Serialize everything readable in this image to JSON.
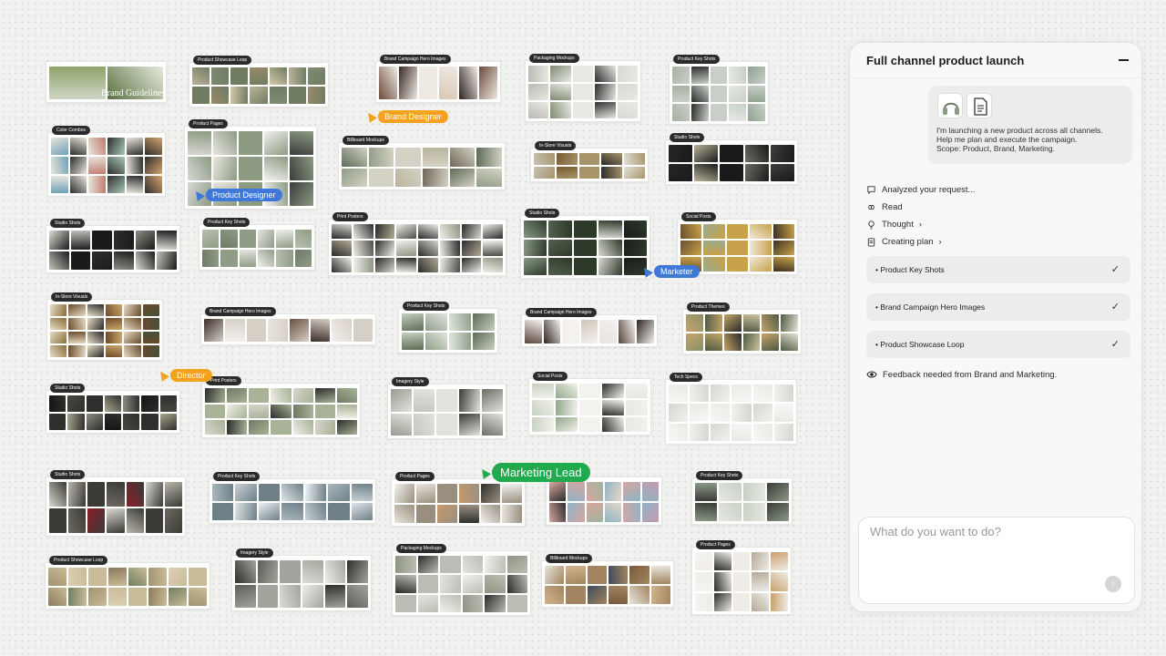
{
  "canvas": {
    "boards": [
      {
        "label": "",
        "cols": 2,
        "rows": 1,
        "palette": [
          "#cfd6c7",
          "#8ea56a",
          "#e6ebe0",
          "#5a7040"
        ],
        "caption": "Brand Guidelines"
      },
      {
        "label": "Product Showcase Loop",
        "cols": 7,
        "rows": 2,
        "palette": [
          "#9a8a6a",
          "#bdb49a",
          "#6f7c62",
          "#d6c9a8",
          "#7e8c74"
        ]
      },
      {
        "label": "Brand Campaign Hero Images",
        "cols": 6,
        "rows": 1,
        "palette": [
          "#3a2a24",
          "#d9c7b5",
          "#6b4b3a",
          "#efe9e3",
          "#2c2422"
        ]
      },
      {
        "label": "Packaging Mockups",
        "cols": 5,
        "rows": 3,
        "palette": [
          "#d9d8d2",
          "#7f8a72",
          "#2f2f2f",
          "#b9b9b2",
          "#e9e8e4"
        ]
      },
      {
        "label": "Product Key Shots",
        "cols": 5,
        "rows": 3,
        "palette": [
          "#c9cfc8",
          "#8fa38f",
          "#2b2b2b",
          "#e7e9e5",
          "#a8b1a2"
        ]
      },
      {
        "label": "Color Combos",
        "cols": 6,
        "rows": 3,
        "palette": [
          "#6fa0b7",
          "#d3a36e",
          "#2d2d2d",
          "#a8c9b9",
          "#c17b6d",
          "#e9e6dc"
        ]
      },
      {
        "label": "Product Pages",
        "cols": 5,
        "rows": 3,
        "palette": [
          "#f2f2f0",
          "#d8d8d4",
          "#8c9a82",
          "#3c3c3c",
          "#e9e6e0"
        ]
      },
      {
        "label": "Billboard Mockups",
        "cols": 6,
        "rows": 2,
        "palette": [
          "#8f9c86",
          "#b9b49e",
          "#5d6b58",
          "#d4d2c4",
          "#6f6658"
        ]
      },
      {
        "label": "In-Store Visuals",
        "cols": 5,
        "rows": 2,
        "palette": [
          "#e3e1db",
          "#7a5a2e",
          "#2a2a2a",
          "#c7c3b7",
          "#a7946a"
        ]
      },
      {
        "label": "Studio Shots",
        "cols": 5,
        "rows": 2,
        "palette": [
          "#1a1a1a",
          "#3d3d3a",
          "#b7b29a",
          "#6b6e62",
          "#262626"
        ]
      },
      {
        "label": "Studio Shots",
        "cols": 6,
        "rows": 2,
        "palette": [
          "#dedcd6",
          "#1b1b1b",
          "#8a8f86",
          "#bfc3bb",
          "#2e2e2e"
        ]
      },
      {
        "label": "Product Key Shots",
        "cols": 6,
        "rows": 2,
        "palette": [
          "#e4e4df",
          "#b8bfb0",
          "#8f9c86",
          "#f1f1ee",
          "#6f7a67"
        ]
      },
      {
        "label": "Print Posters",
        "cols": 8,
        "rows": 3,
        "palette": [
          "#2a2a2a",
          "#d7d5cf",
          "#8d9583",
          "#f0efe9",
          "#4c4c48",
          "#b0aa95"
        ]
      },
      {
        "label": "Studio Shots",
        "cols": 5,
        "rows": 3,
        "palette": [
          "#1c1c1c",
          "#54604d",
          "#d9d8d2",
          "#8a9985",
          "#2d3a2a"
        ]
      },
      {
        "label": "Social Posts",
        "cols": 5,
        "rows": 3,
        "palette": [
          "#c8a24a",
          "#3a2f22",
          "#9cab8d",
          "#efe8d8",
          "#6a4d2c"
        ]
      },
      {
        "label": "In-Store Visuals",
        "cols": 6,
        "rows": 4,
        "palette": [
          "#6b4a2a",
          "#c9a86a",
          "#2a2a2a",
          "#e6dcc6",
          "#8a6d3b",
          "#445039"
        ]
      },
      {
        "label": "Brand Campaign Hero Images",
        "cols": 8,
        "rows": 1,
        "palette": [
          "#e9e5df",
          "#3a2e28",
          "#d6cfc6",
          "#6a4e3e",
          "#f3f1ee"
        ]
      },
      {
        "label": "Product Key Shots",
        "cols": 4,
        "rows": 2,
        "palette": [
          "#8fa08a",
          "#c7cfc1",
          "#5b6b55",
          "#e2e6de"
        ]
      },
      {
        "label": "Brand Campaign Hero Images",
        "cols": 7,
        "rows": 1,
        "palette": [
          "#e6e2dc",
          "#2e2622",
          "#cfc5b9",
          "#57443a",
          "#f4f2ef"
        ]
      },
      {
        "label": "Product Themes",
        "cols": 6,
        "rows": 2,
        "palette": [
          "#2a2a28",
          "#c4a46a",
          "#8b8f6a",
          "#e8e3d5",
          "#4e5a44",
          "#d0c3a0"
        ]
      },
      {
        "label": "Studio Shots",
        "cols": 7,
        "rows": 2,
        "palette": [
          "#141414",
          "#2f2f2d",
          "#8c8c80",
          "#474742",
          "#a8a58e"
        ]
      },
      {
        "label": "Print Posters",
        "cols": 7,
        "rows": 3,
        "palette": [
          "#f1efe9",
          "#2b2b2b",
          "#a7b296",
          "#d8d5cc",
          "#6f7a66"
        ]
      },
      {
        "label": "Imagery Style",
        "cols": 5,
        "rows": 2,
        "palette": [
          "#c6c5be",
          "#3b3b37",
          "#9a9a92",
          "#e3e2dc",
          "#6d6d66"
        ]
      },
      {
        "label": "Social Posts",
        "cols": 5,
        "rows": 3,
        "palette": [
          "#e8e8e3",
          "#93a88a",
          "#2d2d2b",
          "#c7d0bf",
          "#f3f2ee"
        ]
      },
      {
        "label": "Tech Specs",
        "cols": 6,
        "rows": 3,
        "palette": [
          "#f7f7f5",
          "#e9e9e6",
          "#d5d5d1",
          "#f1f1ee"
        ]
      },
      {
        "label": "Studio Shots",
        "cols": 7,
        "rows": 2,
        "palette": [
          "#d9d7d0",
          "#3a3a36",
          "#8a1e2a",
          "#b9b6aa",
          "#6d6a5f"
        ]
      },
      {
        "label": "Product Key Shots",
        "cols": 7,
        "rows": 2,
        "palette": [
          "#dfe5e8",
          "#a9b8bf",
          "#6e7f87",
          "#eef1f2",
          "#c7d1d5"
        ]
      },
      {
        "label": "Product Pages",
        "cols": 6,
        "rows": 2,
        "palette": [
          "#e9e6df",
          "#c49a6c",
          "#f3f2ef",
          "#9a8f7f",
          "#2f2f2d"
        ]
      },
      {
        "label": "",
        "cols": 6,
        "rows": 2,
        "palette": [
          "#c79ab0",
          "#8fb3c5",
          "#e6d7c7",
          "#a0b59a",
          "#d7a6a1",
          "#2d2d2d"
        ]
      },
      {
        "label": "Product Key Shots",
        "cols": 4,
        "rows": 2,
        "palette": [
          "#e7e8e4",
          "#8a9a86",
          "#3a3a36",
          "#c9d0c4"
        ]
      },
      {
        "label": "Product Showcase Loop",
        "cols": 8,
        "rows": 2,
        "palette": [
          "#a19270",
          "#c9bb98",
          "#6f7e61",
          "#dcd0b3",
          "#8b7b5a"
        ]
      },
      {
        "label": "Imagery Style",
        "cols": 6,
        "rows": 2,
        "palette": [
          "#dcdbd5",
          "#2d2d2b",
          "#a5a49c",
          "#eeede9",
          "#5d5d58"
        ]
      },
      {
        "label": "Packaging Mockups",
        "cols": 6,
        "rows": 3,
        "palette": [
          "#2b2b29",
          "#e5e4df",
          "#8e9582",
          "#bdbcb4",
          "#f2f1ed"
        ]
      },
      {
        "label": "Billboard Mockups",
        "cols": 6,
        "rows": 2,
        "palette": [
          "#7a5a3c",
          "#d3b48c",
          "#3f4a5a",
          "#e9e5dd",
          "#a28560"
        ]
      },
      {
        "label": "Product Pages",
        "cols": 5,
        "rows": 3,
        "palette": [
          "#efece6",
          "#c9a06a",
          "#2c2c2a",
          "#b5aa98",
          "#f5f4f1"
        ]
      }
    ],
    "collaborators": [
      {
        "name": "Brand Designer",
        "color": "#f4a21f"
      },
      {
        "name": "Product Designer",
        "color": "#3f78d8"
      },
      {
        "name": "Marketer",
        "color": "#3f78d8"
      },
      {
        "name": "Director",
        "color": "#f4a21f"
      },
      {
        "name": "Marketing Lead",
        "color": "#1faa4e"
      }
    ]
  },
  "panel": {
    "title": "Full channel product launch",
    "request": "I'm launching a new product across all channels.\nHelp me plan and execute the campaign.\nScope: Product, Brand, Marketing.",
    "steps": [
      {
        "icon": "chat-icon",
        "label": "Analyzed your request..."
      },
      {
        "icon": "infinity-icon",
        "label": "Read"
      },
      {
        "icon": "lightbulb-icon",
        "label": "Thought",
        "chevron": "›"
      },
      {
        "icon": "clipboard-icon",
        "label": "Creating plan",
        "chevron": "›"
      }
    ],
    "tasks": [
      {
        "label": "• Product Key Shots",
        "check": "✓"
      },
      {
        "label": "• Brand Campaign Hero Images",
        "check": "✓"
      },
      {
        "label": "• Product Showcase Loop",
        "check": "✓"
      }
    ],
    "feedback": "Feedback needed from Brand and Marketing.",
    "input_placeholder": "What do you want to do?",
    "send_glyph": "↑"
  }
}
